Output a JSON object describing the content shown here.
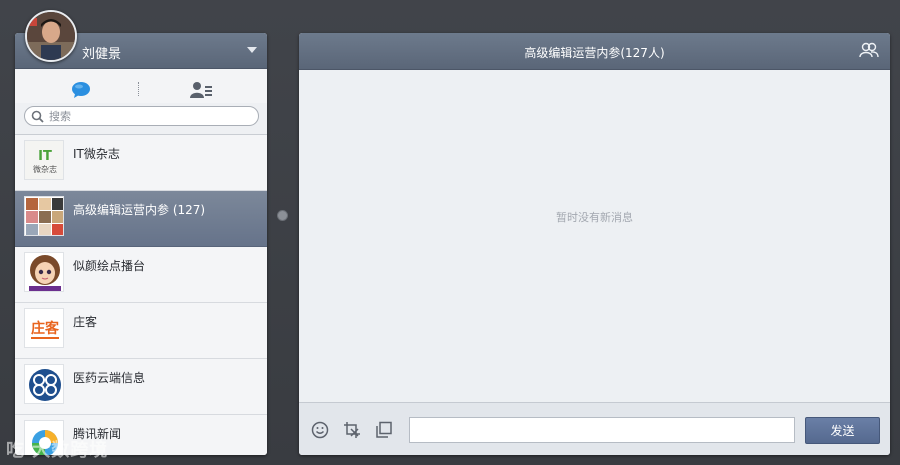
{
  "user": {
    "name": "刘健景"
  },
  "search": {
    "placeholder": "搜索"
  },
  "conversations": [
    {
      "name": "IT微杂志",
      "logo_text_top": "IT",
      "logo_text_bottom": "微杂志"
    },
    {
      "name": "高级编辑运营内参 (127)",
      "active": true
    },
    {
      "name": "似颜绘点播台"
    },
    {
      "name": "庄客",
      "logo_text": "庄客"
    },
    {
      "name": "医药云端信息"
    },
    {
      "name": "腾讯新闻"
    }
  ],
  "chat": {
    "title": "高级编辑运营内参(127人)",
    "empty_message": "暂时没有新消息",
    "input_value": "",
    "send_label": "发送"
  },
  "icons": {
    "chat_tab": "chat-bubble-icon",
    "contacts_tab": "contacts-icon",
    "search": "search-icon",
    "members": "group-members-icon",
    "emoji": "emoji-icon",
    "screenshot": "screenshot-icon",
    "copy": "copy-icon"
  },
  "colors": {
    "header": "#66738a",
    "active_item": "#7c889a",
    "accent_blue": "#2b8fe0",
    "send_button": "#5d7198"
  },
  "watermark": "吃 大数跨境"
}
